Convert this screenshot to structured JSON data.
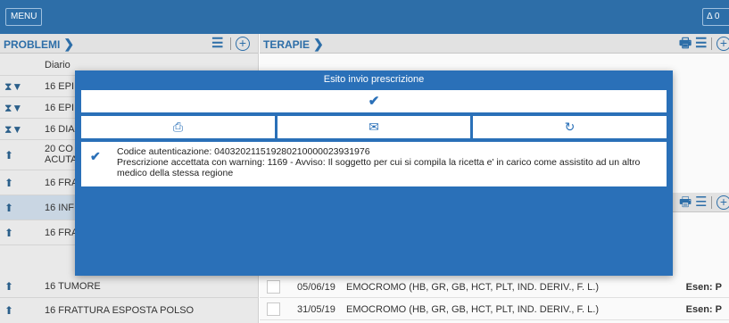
{
  "topbar": {
    "menu_label": "MENU",
    "notif_label": "Δ 0"
  },
  "problems": {
    "title": "PROBLEMI",
    "chevron": "❯",
    "rows": [
      {
        "icon": "",
        "label": "Diario"
      },
      {
        "icon": "⧗▼",
        "label": "16 EPI"
      },
      {
        "icon": "⧗▼",
        "label": "16 EPI"
      },
      {
        "icon": "⧗▼",
        "label": "16 DIA"
      },
      {
        "icon": "⬆",
        "label": "20 CO"
      },
      {
        "icon": "⬆",
        "label": "16 FRA"
      },
      {
        "icon": "⬆",
        "label": "16 INF"
      },
      {
        "icon": "⬆",
        "label": "16 FRA"
      },
      {
        "icon": "⬆",
        "label": "16 TUMORE"
      },
      {
        "icon": "⬆",
        "label": "16 FRATTURA ESPOSTA POLSO"
      }
    ],
    "row5_sub": "ACUTA"
  },
  "therapies": {
    "title": "TERAPIE",
    "chevron": "❯"
  },
  "exams": {
    "rows": [
      {
        "date": "05/06/19",
        "name": "EMOCROMO (HB, GR, GB, HCT, PLT, IND. DERIV., F. L.)",
        "exemption": "Esen: P"
      },
      {
        "date": "31/05/19",
        "name": "EMOCROMO (HB, GR, GB, HCT, PLT, IND. DERIV., F. L.)",
        "exemption": "Esen: P"
      }
    ]
  },
  "modal": {
    "title": "Esito invio prescrizione",
    "confirm_icon": "✔",
    "pdf_icon": "⎙",
    "mail_icon": "✉",
    "sync_icon": "↻",
    "message_line1": "Codice autenticazione: 040320211519280210000023931976",
    "message_line2": "Prescrizione accettata con warning: 1169 - Avviso: Il soggetto per cui si compila la ricetta e' in carico come assistito ad un altro medico della stessa regione",
    "check_icon": "✔"
  }
}
